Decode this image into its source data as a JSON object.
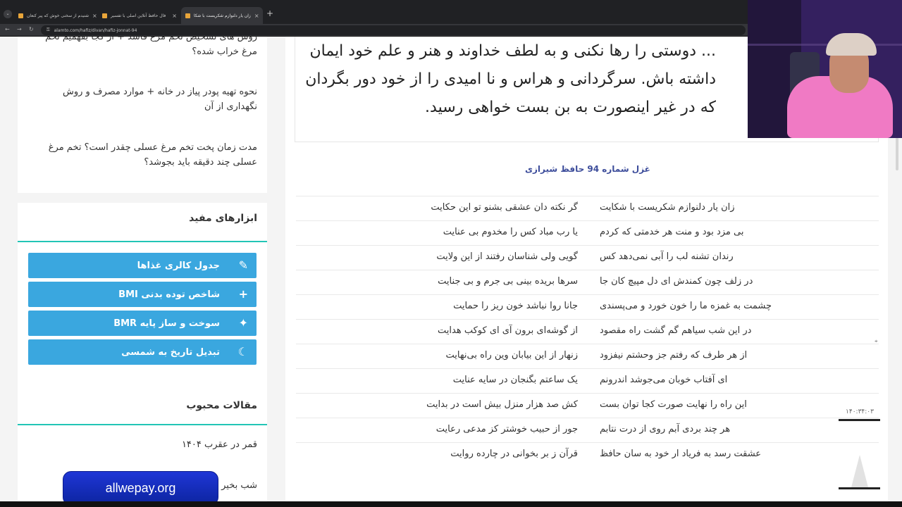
{
  "browser": {
    "tabs": [
      {
        "title": "شنیدم از سخنی خوش که پیر کنعان",
        "active": false
      },
      {
        "title": "فال حافظ آنلاین اصلی با تفسیر",
        "active": false
      },
      {
        "title": "زان یار دلنوازم شکریست با شکا",
        "active": true
      }
    ],
    "url": "alamto.com/hafiz/divan/hafiz-jonnat-94"
  },
  "sidebar": {
    "latest_articles": [
      "روش های تشخیص تخم مرغ فاسد + از کجا بفهمیم تخم مرغ خراب شده؟",
      "نحوه تهیه پودر پیاز در خانه + موارد مصرف و روش نگهداری از آن",
      "مدت زمان پخت تخم مرغ عسلی چقدر است؟ تخم مرغ عسلی چند دقیقه باید بجوشد؟"
    ],
    "tools_title": "ابزارهای مفید",
    "tools": [
      {
        "label": "جدول کالری غذاها",
        "icon": "pencil-icon",
        "glyph": "✎"
      },
      {
        "label": "شاخص توده بدنی BMI",
        "icon": "plus-icon",
        "glyph": "+"
      },
      {
        "label": "سوخت و ساز پایه BMR",
        "icon": "sparkle-icon",
        "glyph": "✦"
      },
      {
        "label": "تبدیل تاریخ به شمسی",
        "icon": "moon-icon",
        "glyph": "☾"
      }
    ],
    "popular_title": "مقالات محبوب",
    "popular": [
      "قمر در عقرب ۱۴۰۴",
      "شب بخیر"
    ]
  },
  "main": {
    "interpretation": "... دوستی را رها نکنی و به لطف خداوند و هنر و علم خود ایمان داشته باش. سرگردانی و هراس و نا امیدی را از خود دور بگردان که در غیر اینصورت به بن بست خواهی رسید.",
    "poem_title": "غزل شماره 94 حافظ شیرازی",
    "verses": [
      [
        "زان یار دلنوازم شکریست با شکایت",
        "گر نکته دان عشقی بشنو تو این حکایت"
      ],
      [
        "بی مزد بود و منت هر خدمتی که کردم",
        "یا رب مباد کس را مخدوم بی عنایت"
      ],
      [
        "رندان تشنه لب را آبی نمی‌دهد کس",
        "گویی ولی شناسان رفتند از این ولایت"
      ],
      [
        "در زلف چون کمندش ای دل مپیچ کان جا",
        "سرها بریده بینی بی جرم و بی جنایت"
      ],
      [
        "چشمت به غمزه ما را خون خورد و می‌پسندی",
        "جانا روا نباشد خون ریز را حمایت"
      ],
      [
        "در این شب سیاهم گم گشت راه مقصود",
        "از گوشه‌ای برون آی ای کوکب هدایت"
      ],
      [
        "از هر طرف که رفتم جز وحشتم نیفزود",
        "زنهار از این بیابان وین راه بی‌نهایت"
      ],
      [
        "ای آفتاب خوبان می‌جوشد اندرونم",
        "یک ساعتم بگنجان در سایه عنایت"
      ],
      [
        "این راه را نهایت صورت کجا توان بست",
        "کش صد هزار منزل بیش است در بدایت"
      ],
      [
        "هر چند بردی آبم روی از درت نتابم",
        "جور از حبیب خوشتر کز مدعی رعایت"
      ],
      [
        "عشقت رسد به فریاد ار خود به سان حافظ",
        "قرآن ز بر بخوانی در چارده روایت"
      ]
    ]
  },
  "overlay": {
    "ad_text": "allwepay.org",
    "timer_text": "۱۴۰:۳۴:۰۳"
  }
}
